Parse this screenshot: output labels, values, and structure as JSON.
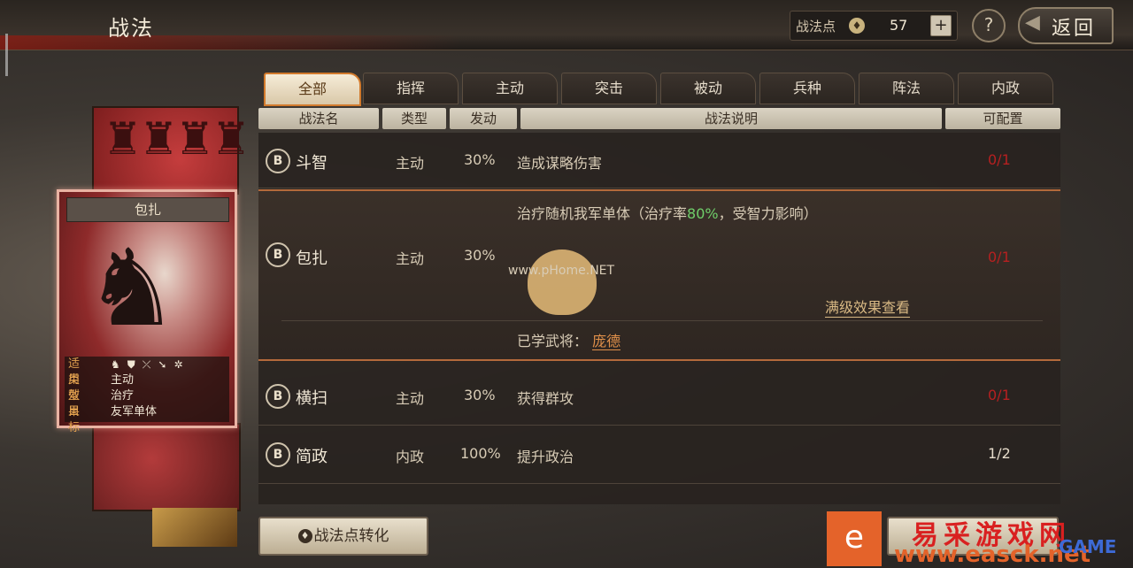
{
  "header": {
    "title": "战法",
    "points_label": "战法点",
    "points_value": "57",
    "plus_label": "+",
    "help_label": "?",
    "back_label": "返回"
  },
  "tabs": [
    {
      "label": "全部",
      "active": true
    },
    {
      "label": "指挥"
    },
    {
      "label": "主动"
    },
    {
      "label": "突击"
    },
    {
      "label": "被动"
    },
    {
      "label": "兵种"
    },
    {
      "label": "阵法"
    },
    {
      "label": "内政"
    }
  ],
  "columns": [
    "战法名",
    "类型",
    "发动",
    "战法说明",
    "可配置"
  ],
  "rows": [
    {
      "grade": "B",
      "name": "斗智",
      "type": "主动",
      "rate": "30%",
      "desc": "造成谋略伤害",
      "count": "0/1",
      "count_color": "#b62020"
    },
    {
      "grade": "B",
      "name": "包扎",
      "type": "主动",
      "rate": "30%",
      "desc_pre": "治疗随机我军单体（治疗率",
      "desc_highlight": "80%",
      "desc_post": "，受智力影响）",
      "count": "0/1",
      "count_color": "#b62020",
      "fullview": "满级效果查看",
      "learned_label": "已学武将：",
      "learned_general": "庞德"
    },
    {
      "grade": "B",
      "name": "横扫",
      "type": "主动",
      "rate": "30%",
      "desc": "获得群攻",
      "count": "0/1",
      "count_color": "#b62020"
    },
    {
      "grade": "B",
      "name": "简政",
      "type": "内政",
      "rate": "100%",
      "desc": "提升政治",
      "count": "1/2",
      "count_color": "#e6dccb"
    }
  ],
  "card": {
    "name": "包扎",
    "info": [
      {
        "key": "适用",
        "value": ""
      },
      {
        "key": "类型",
        "value": "主动"
      },
      {
        "key": "效果",
        "value": "治疗"
      },
      {
        "key": "目标",
        "value": "友军单体"
      }
    ],
    "unit_icons": [
      "cavalry-icon",
      "shield-icon",
      "bow-icon",
      "spear-icon",
      "wheel-icon"
    ]
  },
  "footer": {
    "convert_label": "战法点转化"
  },
  "watermarks": {
    "phome": "www.pHome.NET",
    "site_name": "易采游戏网",
    "site_url": "www.easck.net",
    "game": "GAME"
  }
}
